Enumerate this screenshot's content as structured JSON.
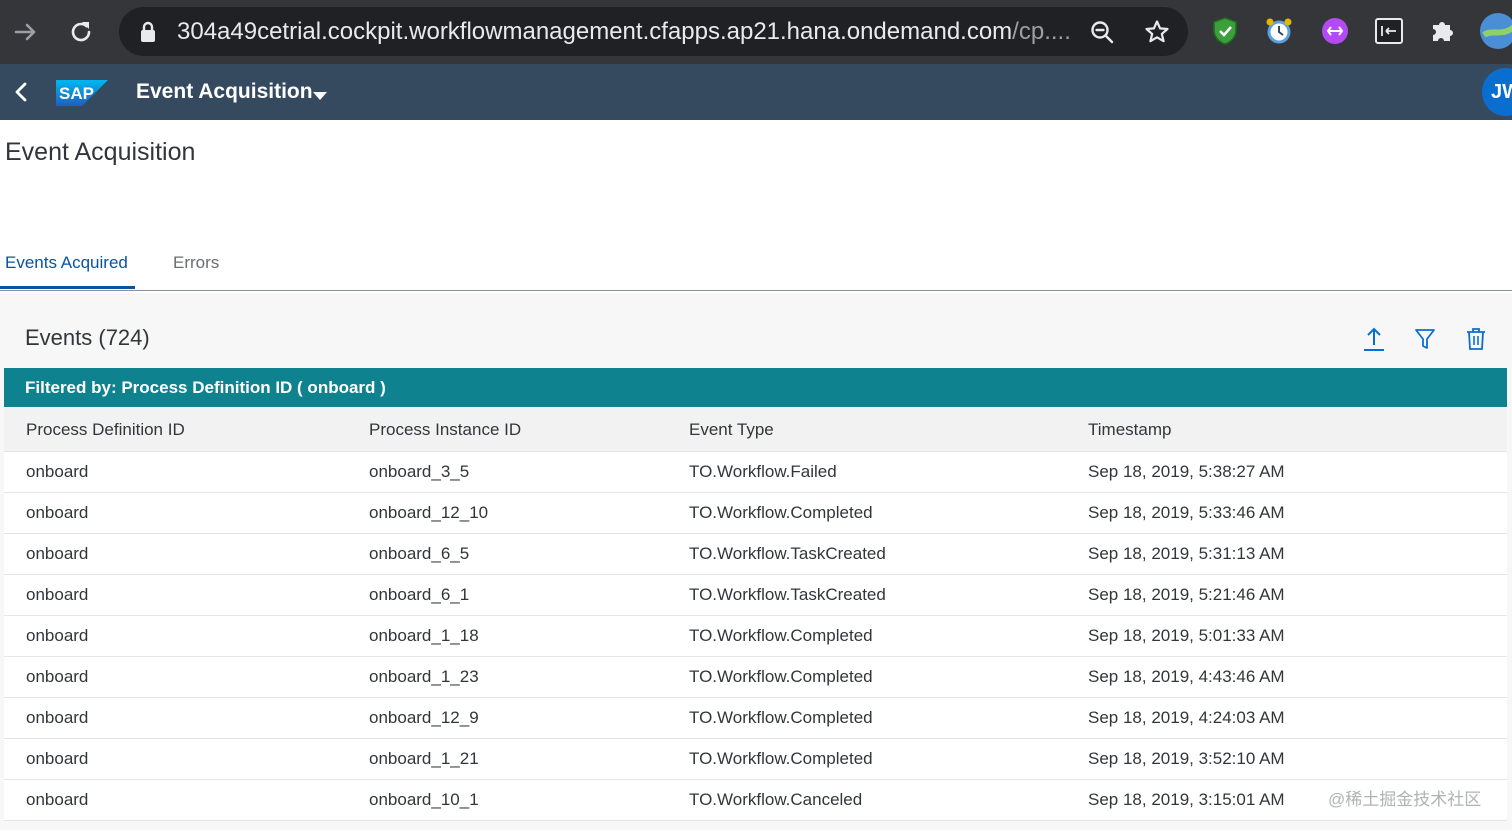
{
  "browser": {
    "url_main": "304a49cetrial.cockpit.workflowmanagement.cfapps.ap21.hana.ondemand.com",
    "url_rest": "/cp...."
  },
  "shell": {
    "logo": "SAP",
    "title": "Event Acquisition",
    "avatar_initials": "JW"
  },
  "page": {
    "title": "Event Acquisition"
  },
  "tabs": [
    {
      "label": "Events Acquired",
      "selected": true
    },
    {
      "label": "Errors",
      "selected": false
    }
  ],
  "table": {
    "title": "Events (724)",
    "filter_info": "Filtered by: Process Definition ID ( onboard )",
    "columns": [
      "Process Definition ID",
      "Process Instance ID",
      "Event Type",
      "Timestamp"
    ],
    "rows": [
      [
        "onboard",
        "onboard_3_5",
        "TO.Workflow.Failed",
        "Sep 18, 2019, 5:38:27 AM"
      ],
      [
        "onboard",
        "onboard_12_10",
        "TO.Workflow.Completed",
        "Sep 18, 2019, 5:33:46 AM"
      ],
      [
        "onboard",
        "onboard_6_5",
        "TO.Workflow.TaskCreated",
        "Sep 18, 2019, 5:31:13 AM"
      ],
      [
        "onboard",
        "onboard_6_1",
        "TO.Workflow.TaskCreated",
        "Sep 18, 2019, 5:21:46 AM"
      ],
      [
        "onboard",
        "onboard_1_18",
        "TO.Workflow.Completed",
        "Sep 18, 2019, 5:01:33 AM"
      ],
      [
        "onboard",
        "onboard_1_23",
        "TO.Workflow.Completed",
        "Sep 18, 2019, 4:43:46 AM"
      ],
      [
        "onboard",
        "onboard_12_9",
        "TO.Workflow.Completed",
        "Sep 18, 2019, 4:24:03 AM"
      ],
      [
        "onboard",
        "onboard_1_21",
        "TO.Workflow.Completed",
        "Sep 18, 2019, 3:52:10 AM"
      ],
      [
        "onboard",
        "onboard_10_1",
        "TO.Workflow.Canceled",
        "Sep 18, 2019, 3:15:01 AM"
      ]
    ]
  },
  "watermark": "@稀土掘金技术社区",
  "colors": {
    "shell_bg": "#354a5f",
    "filter_bar": "#0f828f",
    "tab_active": "#0854a0",
    "browser_bg": "#35363a"
  }
}
